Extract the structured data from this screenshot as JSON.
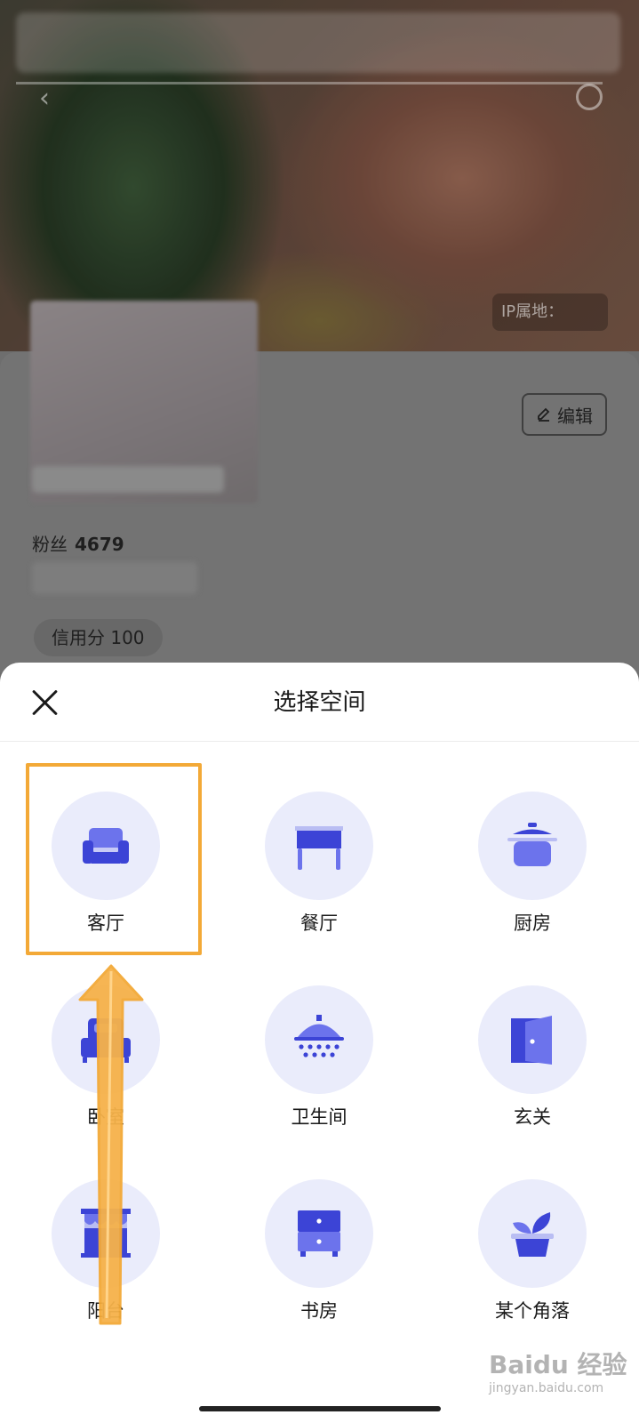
{
  "profile": {
    "ip_label": "IP属地：",
    "edit_label": "编辑",
    "fans_label": "粉丝",
    "fans_count": "4679",
    "credit_label": "信用分 100"
  },
  "sheet": {
    "title": "选择空间",
    "spaces": [
      {
        "label": "客厅",
        "icon": "sofa-icon"
      },
      {
        "label": "餐厅",
        "icon": "dining-table-icon"
      },
      {
        "label": "厨房",
        "icon": "pot-icon"
      },
      {
        "label": "卧室",
        "icon": "bed-icon"
      },
      {
        "label": "卫生间",
        "icon": "shower-icon"
      },
      {
        "label": "玄关",
        "icon": "door-icon"
      },
      {
        "label": "阳台",
        "icon": "balcony-icon"
      },
      {
        "label": "书房",
        "icon": "cabinet-icon"
      },
      {
        "label": "某个角落",
        "icon": "plant-icon"
      }
    ]
  },
  "colors": {
    "icon_primary": "#3c44d6",
    "icon_circle": "#eaecfb",
    "highlight": "#f3a937"
  },
  "watermark": {
    "main": "Baidu 经验",
    "sub": "jingyan.baidu.com"
  }
}
